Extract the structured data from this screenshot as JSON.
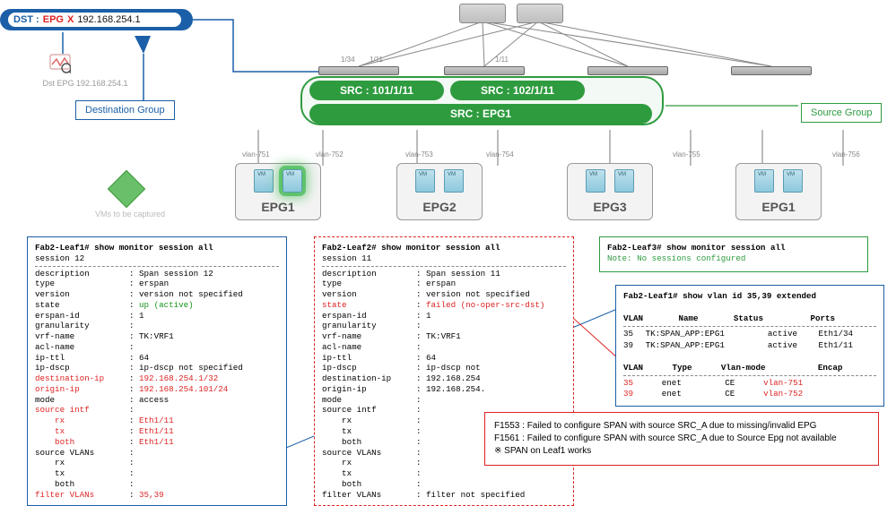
{
  "dst": {
    "label": "DST :",
    "epg": "EPG",
    "x": "X",
    "ip": "192.168.254.1"
  },
  "analyzer_label": "Dst EPG 192.168.254.1",
  "callout_dest": "Destination Group",
  "callout_src": "Source Group",
  "src_pills": {
    "a": "SRC : 101/1/11",
    "b": "SRC : 102/1/11",
    "c": "SRC : EPG1"
  },
  "ports": {
    "p1": "1/34",
    "p2": "1/11",
    "p3": "1/11"
  },
  "vlans": {
    "v1": "vlan-751",
    "v2": "vlan-752",
    "v3": "vlan-753",
    "v4": "vlan-754",
    "v5": "vlan-755",
    "v6": "vlan-756"
  },
  "server_groups": {
    "g1": "EPG1",
    "g2": "EPG2",
    "g3": "EPG3",
    "g4": "EPG1"
  },
  "vm_caption": "VMs to be captured",
  "leaf1": {
    "header": "Fab2-Leaf1# show monitor session all",
    "session": " session 12",
    "rows": [
      [
        "description",
        "Span session 12",
        ""
      ],
      [
        "type",
        "erspan",
        ""
      ],
      [
        "version",
        "version not specified",
        ""
      ],
      [
        "state",
        "up (active)",
        "grn"
      ],
      [
        "erspan-id",
        "1",
        ""
      ],
      [
        "granularity",
        "",
        ""
      ],
      [
        "vrf-name",
        "TK:VRF1",
        ""
      ],
      [
        "acl-name",
        "",
        ""
      ],
      [
        "ip-ttl",
        "64",
        ""
      ],
      [
        "ip-dscp",
        "ip-dscp not specified",
        ""
      ],
      [
        "destination-ip",
        "192.168.254.1/32",
        "red"
      ],
      [
        "origin-ip",
        "192.168.254.101/24",
        "red"
      ],
      [
        "mode",
        "access",
        ""
      ],
      [
        "source intf",
        "",
        "red"
      ],
      [
        "    rx",
        "Eth1/11",
        "red"
      ],
      [
        "    tx",
        "Eth1/11",
        "red"
      ],
      [
        "    both",
        "Eth1/11",
        "red"
      ],
      [
        "source VLANs",
        "",
        ""
      ],
      [
        "    rx",
        "",
        ""
      ],
      [
        "    tx",
        "",
        ""
      ],
      [
        "    both",
        "",
        ""
      ],
      [
        "filter VLANs",
        "35,39",
        "red"
      ]
    ]
  },
  "leaf2": {
    "header": "Fab2-Leaf2# show monitor session all",
    "session": " session 11",
    "rows": [
      [
        "description",
        "Span session 11",
        ""
      ],
      [
        "type",
        "erspan",
        ""
      ],
      [
        "version",
        "version not specified",
        ""
      ],
      [
        "state",
        "failed (no-oper-src-dst)",
        "red"
      ],
      [
        "erspan-id",
        "1",
        ""
      ],
      [
        "granularity",
        "",
        ""
      ],
      [
        "vrf-name",
        "TK:VRF1",
        ""
      ],
      [
        "acl-name",
        "",
        ""
      ],
      [
        "ip-ttl",
        "64",
        ""
      ],
      [
        "ip-dscp",
        "ip-dscp not",
        ""
      ],
      [
        "destination-ip",
        "192.168.254",
        ""
      ],
      [
        "origin-ip",
        "192.168.254.",
        ""
      ],
      [
        "mode",
        "",
        ""
      ],
      [
        "source intf",
        "",
        ""
      ],
      [
        "    rx",
        "",
        ""
      ],
      [
        "    tx",
        "",
        ""
      ],
      [
        "    both",
        "",
        ""
      ],
      [
        "source VLANs",
        "",
        ""
      ],
      [
        "    rx",
        "",
        ""
      ],
      [
        "    tx",
        "",
        ""
      ],
      [
        "    both",
        "",
        ""
      ],
      [
        "filter VLANs",
        "filter not specified",
        ""
      ]
    ]
  },
  "leaf3": {
    "header": "Fab2-Leaf3# show monitor session all",
    "note": "Note: No sessions configured"
  },
  "vlan_ext": {
    "header": "Fab2-Leaf1# show vlan id 35,39 extended",
    "cols1": [
      "VLAN",
      "Name",
      "Status",
      "Ports"
    ],
    "rows1": [
      [
        "35",
        "TK:SPAN_APP:EPG1",
        "active",
        "Eth1/34"
      ],
      [
        "39",
        "TK:SPAN_APP:EPG1",
        "active",
        "Eth1/11"
      ]
    ],
    "cols2": [
      "VLAN",
      "Type",
      "Vlan-mode",
      "Encap"
    ],
    "rows2": [
      [
        "35",
        "enet",
        "CE",
        "vlan-751"
      ],
      [
        "39",
        "enet",
        "CE",
        "vlan-752"
      ]
    ]
  },
  "errors": {
    "l1": "F1553 : Failed to configure SPAN with source SRC_A due to missing/invalid EPG",
    "l2": "F1561 : Failed to configure SPAN with source SRC_A due to Source Epg not available",
    "l3": "※  SPAN on Leaf1 works"
  }
}
